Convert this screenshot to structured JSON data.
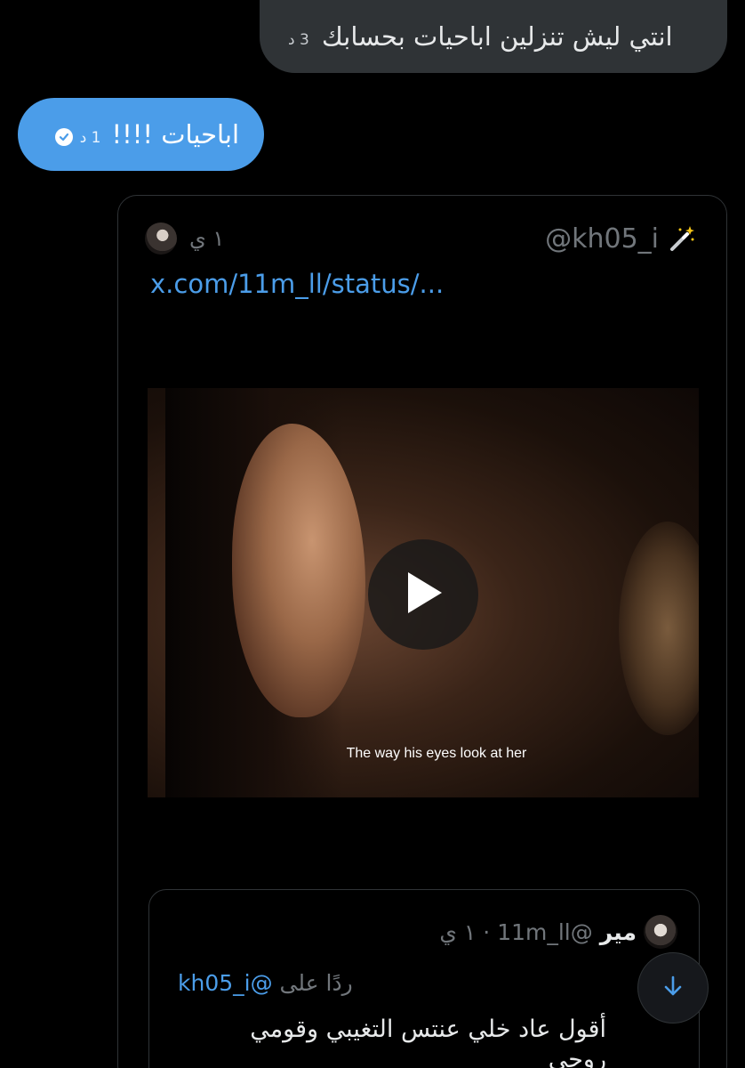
{
  "messages": {
    "incoming": {
      "text": "انتي ليش تنزلين اباحيات بحسابك",
      "time": "3 د"
    },
    "outgoing": {
      "text": "اباحيات !!!!",
      "time": "1 د"
    }
  },
  "card": {
    "time": "١ ي",
    "handle": "@kh05_i",
    "link": "x.com/11m_ll/status/...",
    "video_caption": "The way his eyes look at her",
    "quote": {
      "name": "مير",
      "handle": "@11m_ll",
      "time": "· ١ ي",
      "reply_prefix": "ردًا على",
      "reply_mention": "@kh05_i",
      "body": "أقول عاد خلي عنتس التغيبي وقومي روحي"
    }
  },
  "icons": {
    "wand": "magic-wand-icon",
    "play": "play-icon",
    "check": "check-icon",
    "scroll": "arrow-down-icon"
  },
  "colors": {
    "accent": "#4b9de9",
    "bubble_in": "#2f3336",
    "muted": "#71767b"
  }
}
